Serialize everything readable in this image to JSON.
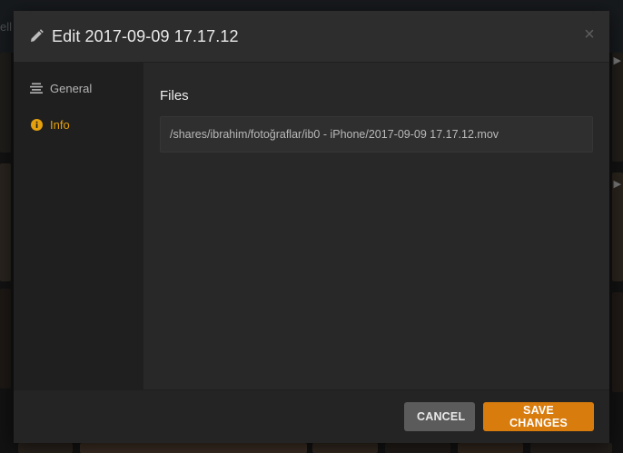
{
  "background": {
    "left_text": "ell"
  },
  "modal": {
    "title": "Edit 2017-09-09 17.17.12",
    "close_glyph": "×",
    "icons": {
      "header": "pencil-icon",
      "close": "close-icon"
    }
  },
  "sidebar": {
    "items": [
      {
        "label": "General",
        "icon": "list-icon",
        "active": false
      },
      {
        "label": "Info",
        "icon": "info-icon",
        "active": true
      }
    ]
  },
  "content": {
    "section_title": "Files",
    "file_path": "/shares/ibrahim/fotoğraflar/ib0 - iPhone/2017-09-09 17.17.12.mov"
  },
  "footer": {
    "cancel_label": "Cancel",
    "save_label": "Save Changes"
  },
  "colors": {
    "accent": "#e5a00d",
    "save_button": "#d97c0e",
    "cancel_button": "#5b5b5b"
  }
}
